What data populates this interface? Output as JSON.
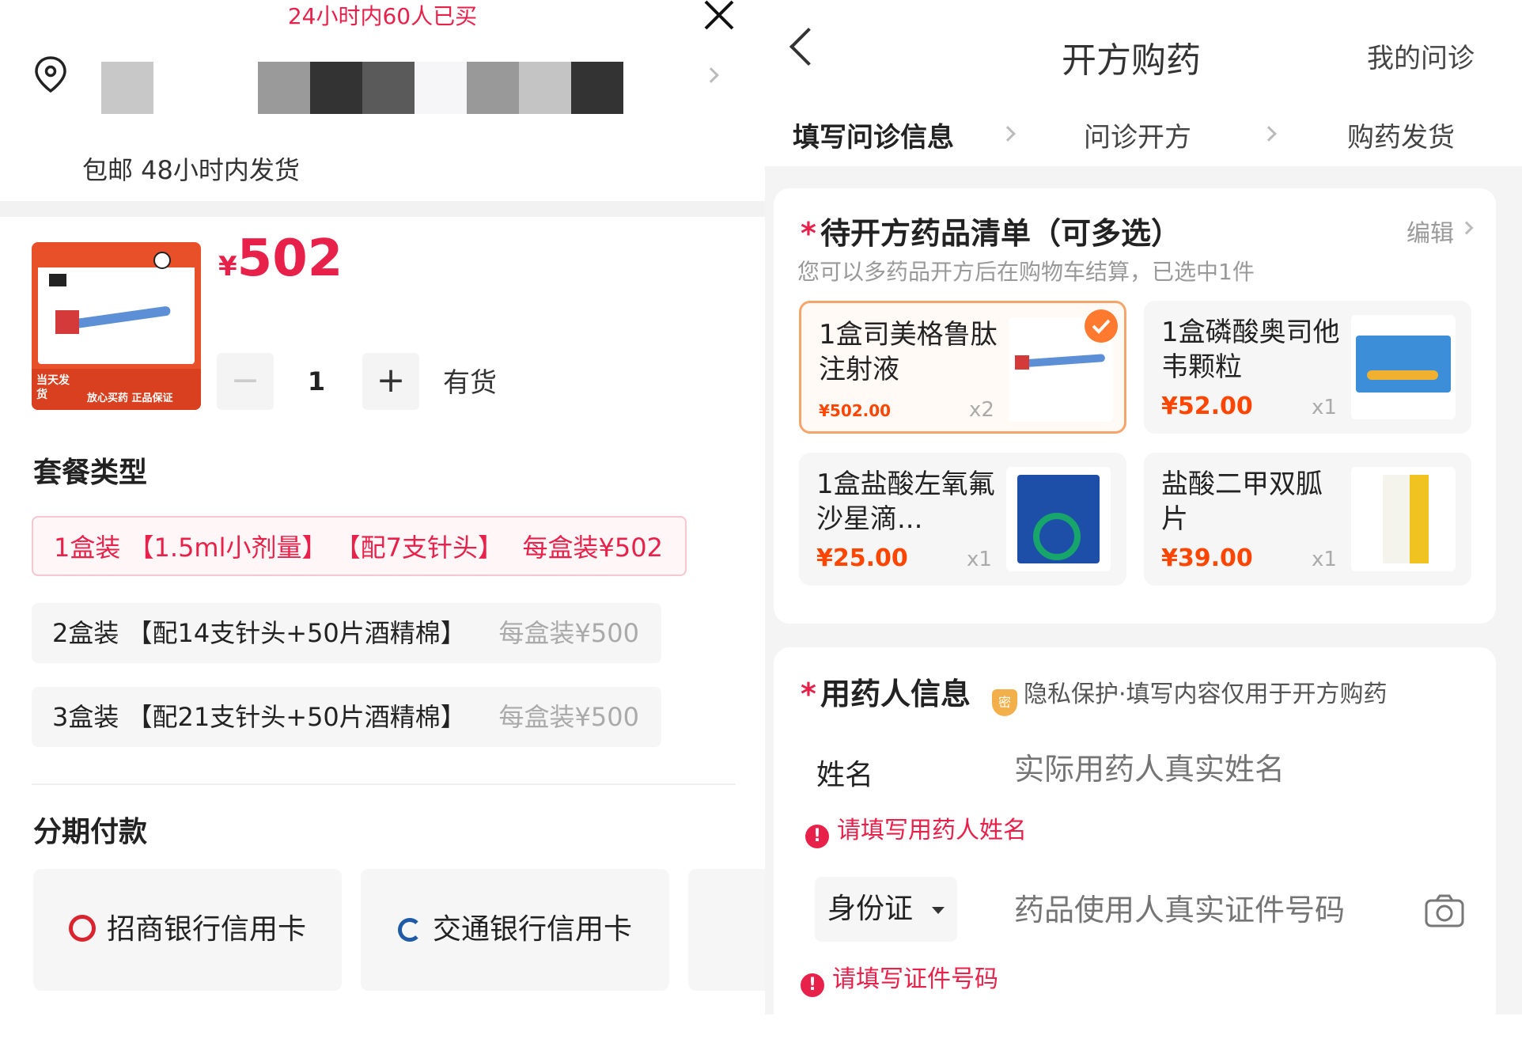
{
  "left": {
    "banner": "24小时内60人已买",
    "shipping": "包邮 48小时内发货",
    "product": {
      "price_symbol": "¥",
      "price": "502",
      "quantity": "1",
      "stock": "有货",
      "image_tag1": "当天发货",
      "image_tag2": "放心买药 正品保证"
    },
    "package_section_title": "套餐类型",
    "packages": [
      {
        "label": "1盒装 【1.5ml小剂量】 【配7支针头】",
        "per": "每盒装¥502",
        "selected": true
      },
      {
        "label": "2盒装 【配14支针头+50片酒精棉】",
        "per": "每盒装¥500",
        "selected": false
      },
      {
        "label": "3盒装 【配21支针头+50片酒精棉】",
        "per": "每盒装¥500",
        "selected": false
      }
    ],
    "installment_title": "分期付款",
    "banks": [
      "招商银行信用卡",
      "交通银行信用卡"
    ]
  },
  "right": {
    "header": {
      "title": "开方购药",
      "my_consult": "我的问诊"
    },
    "steps": [
      "填写问诊信息",
      "问诊开方",
      "购药发货"
    ],
    "med_list": {
      "title": "待开方药品清单（可多选）",
      "edit": "编辑",
      "note": "您可以多药品开方后在购物车结算，已选中1件",
      "items": [
        {
          "name": "1盒司美格鲁肽注射液",
          "price": "¥502.00",
          "qty": "x2",
          "selected": true
        },
        {
          "name": "1盒磷酸奥司他韦颗粒",
          "price": "¥52.00",
          "qty": "x1",
          "selected": false
        },
        {
          "name": "1盒盐酸左氧氟沙星滴...",
          "price": "¥25.00",
          "qty": "x1",
          "selected": false
        },
        {
          "name": "盐酸二甲双胍片",
          "price": "¥39.00",
          "qty": "x1",
          "selected": false
        }
      ]
    },
    "patient": {
      "title": "用药人信息",
      "privacy": "隐私保护·填写内容仅用于开方购药",
      "privacy_badge": "密",
      "name_label": "姓名",
      "name_placeholder": "实际用药人真实姓名",
      "name_error": "请填写用药人姓名",
      "id_type": "身份证",
      "id_placeholder": "药品使用人真实证件号码",
      "id_error": "请填写证件号码"
    }
  },
  "colors": {
    "accent_red": "#e8214b",
    "orange": "#ff7a2e",
    "price_orange": "#ff4500"
  }
}
